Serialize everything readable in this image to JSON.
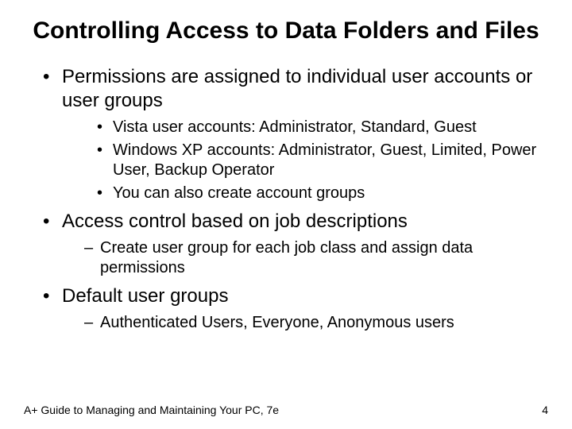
{
  "title": "Controlling Access to Data Folders and Files",
  "bullets": {
    "b1": "Permissions are assigned to individual user accounts or user groups",
    "b1_sub": {
      "s1": "Vista user accounts: Administrator, Standard, Guest",
      "s2": "Windows XP accounts: Administrator, Guest, Limited, Power User, Backup Operator",
      "s3": "You can also create account groups"
    },
    "b2": "Access control based on job descriptions",
    "b2_sub": {
      "s1": "Create user group for each job class and assign data permissions"
    },
    "b3": "Default user groups",
    "b3_sub": {
      "s1": "Authenticated Users, Everyone, Anonymous users"
    }
  },
  "footer": {
    "left": "A+ Guide to Managing and Maintaining Your PC, 7e",
    "right": "4"
  }
}
